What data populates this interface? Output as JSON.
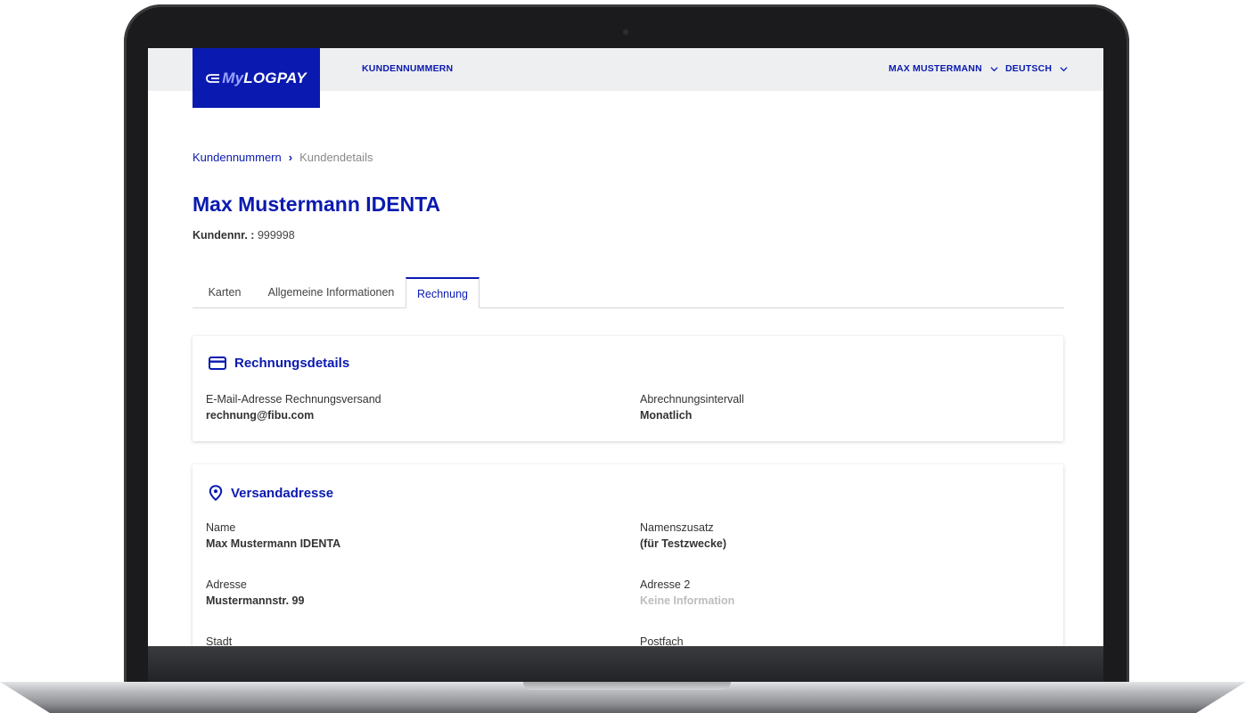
{
  "header": {
    "logo": "MyLOGPAY",
    "nav_link": "KUNDENNUMMERN",
    "user_menu": "MAX MUSTERMANN",
    "language_menu": "DEUTSCH"
  },
  "breadcrumb": {
    "parent": "Kundennummern",
    "current": "Kundendetails"
  },
  "page": {
    "title": "Max Mustermann IDENTA",
    "customer_no_label": "Kundennr. :",
    "customer_no_value": "999998"
  },
  "tabs": [
    {
      "label": "Karten",
      "active": false
    },
    {
      "label": "Allgemeine Informationen",
      "active": false
    },
    {
      "label": "Rechnung",
      "active": true
    }
  ],
  "billing_card": {
    "title": "Rechnungsdetails",
    "icon": "credit-card-icon",
    "fields": [
      {
        "label": "E-Mail-Adresse Rechnungsversand",
        "value": "rechnung@fibu.com"
      },
      {
        "label": "Abrechnungsintervall",
        "value": "Monatlich"
      }
    ]
  },
  "shipping_card": {
    "title": "Versandadresse",
    "icon": "location-pin-icon",
    "fields": [
      {
        "label": "Name",
        "value": "Max Mustermann IDENTA"
      },
      {
        "label": "Namenszusatz",
        "value": "(für Testzwecke)"
      },
      {
        "label": "Adresse",
        "value": "Mustermannstr. 99"
      },
      {
        "label": "Adresse 2",
        "value": "Keine Information"
      },
      {
        "label": "Stadt",
        "value": ""
      },
      {
        "label": "Postfach",
        "value": ""
      }
    ]
  },
  "colors": {
    "brand": "#0a1ab0",
    "topbar": "#eeeff0",
    "muted_text": "#bdbdbd"
  }
}
